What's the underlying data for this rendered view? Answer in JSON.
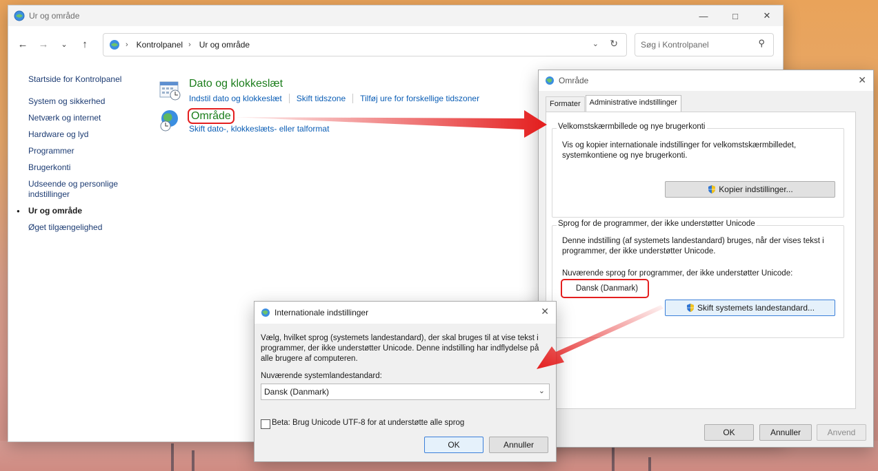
{
  "control_panel": {
    "title": "Ur og område",
    "breadcrumb": [
      "Kontrolpanel",
      "Ur og område"
    ],
    "search_placeholder": "Søg i Kontrolpanel",
    "sidebar": [
      {
        "label": "Startside for Kontrolpanel",
        "current": false
      },
      {
        "label": "System og sikkerhed",
        "current": false
      },
      {
        "label": "Netværk og internet",
        "current": false
      },
      {
        "label": "Hardware og lyd",
        "current": false
      },
      {
        "label": "Programmer",
        "current": false
      },
      {
        "label": "Brugerkonti",
        "current": false
      },
      {
        "label": "Udseende og personlige indstillinger",
        "current": false
      },
      {
        "label": "Ur og område",
        "current": true
      },
      {
        "label": "Øget tilgængelighed",
        "current": false
      }
    ],
    "categories": [
      {
        "title": "Dato og klokkeslæt",
        "links": [
          "Indstil dato og klokkeslæt",
          "Skift tidszone",
          "Tilføj ure for forskellige tidszoner"
        ]
      },
      {
        "title": "Område",
        "links": [
          "Skift dato-, klokkeslæts- eller talformat"
        ]
      }
    ]
  },
  "region_dialog": {
    "title": "Område",
    "tabs": [
      "Formater",
      "Administrative indstillinger"
    ],
    "active_tab": "Administrative indstillinger",
    "welcome_group": {
      "title": "Velkomstskærmbillede og nye brugerkonti",
      "text": "Vis og kopier internationale indstillinger for velkomstskærmbilledet, systemkontiene og nye brugerkonti.",
      "button": "Kopier indstillinger..."
    },
    "unicode_group": {
      "title": "Sprog for de programmer, der ikke understøtter Unicode",
      "text": "Denne indstilling (af systemets landestandard) bruges, når der vises tekst i programmer, der ikke understøtter Unicode.",
      "current_label": "Nuværende sprog for programmer, der ikke understøtter Unicode:",
      "current_value": "Dansk (Danmark)",
      "button": "Skift systemets landestandard..."
    },
    "buttons": {
      "ok": "OK",
      "cancel": "Annuller",
      "apply": "Anvend"
    }
  },
  "intl_dialog": {
    "title": "Internationale indstillinger",
    "description": "Vælg, hvilket sprog (systemets landestandard), der skal bruges til at vise tekst i programmer, der ikke understøtter Unicode. Denne indstilling har indflydelse på alle brugere af computeren.",
    "field_label": "Nuværende systemlandestandard:",
    "selected_value": "Dansk (Danmark)",
    "beta_checkbox": "Beta: Brug Unicode UTF-8 for at understøtte alle sprog",
    "ok": "OK",
    "cancel": "Annuller"
  },
  "colors": {
    "annotation_red": "#e41e1e",
    "link_blue": "#0a5db5",
    "category_green": "#1b7d1b"
  }
}
